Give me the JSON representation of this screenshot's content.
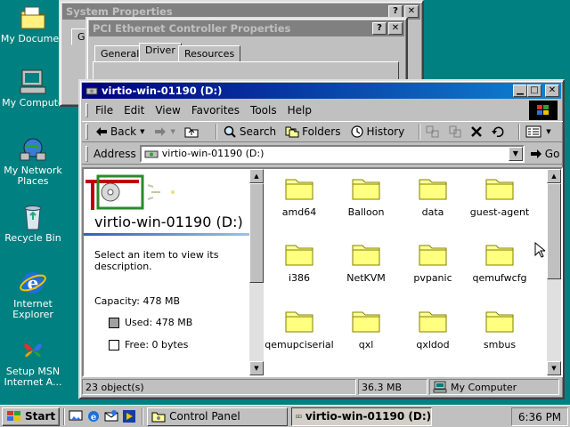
{
  "desktop": {
    "icons": [
      {
        "label": "My Documen"
      },
      {
        "label": "My Compute"
      },
      {
        "label": "My Network Places"
      },
      {
        "label": "Recycle Bin"
      },
      {
        "label": "Internet Explorer"
      },
      {
        "label": "Setup MSN Internet A..."
      }
    ]
  },
  "back_windows": {
    "system_properties": {
      "title": "System Properties",
      "tab_partial": "Ge"
    },
    "pci_properties": {
      "title": "PCI Ethernet Controller Properties",
      "tabs": [
        "General",
        "Driver",
        "Resources"
      ]
    }
  },
  "explorer": {
    "title": "virtio-win-01190 (D:)",
    "menu": [
      "File",
      "Edit",
      "View",
      "Favorites",
      "Tools",
      "Help"
    ],
    "toolbar": {
      "back": "Back",
      "search": "Search",
      "folders": "Folders",
      "history": "History"
    },
    "address": {
      "label": "Address",
      "value": "virtio-win-01190 (D:)",
      "go": "Go"
    },
    "left_pane": {
      "drive_title": "virtio-win-01190 (D:)",
      "hint": "Select an item to view its description.",
      "capacity": "Capacity: 478 MB",
      "used": "Used: 478 MB",
      "free": "Free: 0 bytes"
    },
    "folders": [
      "amd64",
      "Balloon",
      "data",
      "guest-agent",
      "i386",
      "NetKVM",
      "pvpanic",
      "qemufwcfg",
      "qemupciserial",
      "qxl",
      "qxldod",
      "smbus"
    ],
    "status": {
      "objects": "23 object(s)",
      "size": "36.3 MB",
      "zone": "My Computer"
    }
  },
  "taskbar": {
    "start": "Start",
    "buttons": [
      "Control Panel",
      "virtio-win-01190 (D:)"
    ],
    "clock": "6:36 PM"
  },
  "colors": {
    "desktop": "#008080",
    "titlebar_active": "#000080",
    "titlebar_inactive": "#808080",
    "folder": "#ffff99"
  }
}
